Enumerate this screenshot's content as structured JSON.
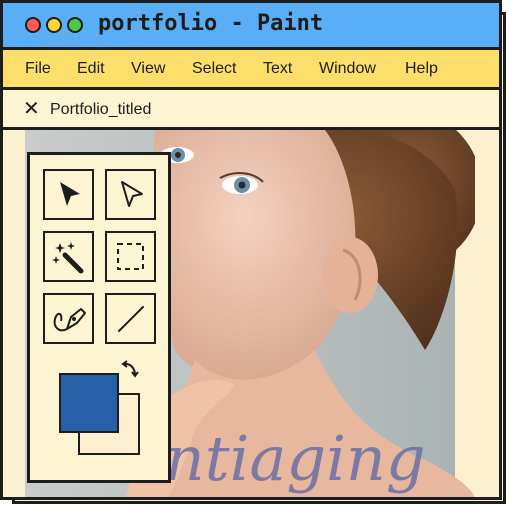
{
  "window": {
    "title": "portfolio - Paint"
  },
  "titlebar": {
    "buttons": [
      {
        "name": "close",
        "color": "#ff5c55"
      },
      {
        "name": "minimize",
        "color": "#ffd43a"
      },
      {
        "name": "maximize",
        "color": "#4dc84c"
      }
    ]
  },
  "menubar": {
    "items": [
      "File",
      "Edit",
      "View",
      "Select",
      "Text",
      "Window",
      "Help"
    ]
  },
  "tab": {
    "close_glyph": "✕",
    "label": "Portfolio_titled"
  },
  "toolbox": {
    "tools": [
      {
        "name": "selection-arrow-icon"
      },
      {
        "name": "direct-selection-arrow-icon"
      },
      {
        "name": "magic-wand-icon"
      },
      {
        "name": "marquee-select-icon"
      },
      {
        "name": "pen-tool-icon"
      },
      {
        "name": "line-tool-icon"
      }
    ],
    "foreground_color": "#2860a8",
    "background_color": "#fdeed0",
    "swap_icon": "swap-colors-icon"
  },
  "canvas": {
    "overlay_text": "Antiaging"
  },
  "colors": {
    "titlebar": "#5aaef5",
    "menubar": "#fcdf6a",
    "panel": "#fdf5d2",
    "outline": "#1d1d1d"
  }
}
